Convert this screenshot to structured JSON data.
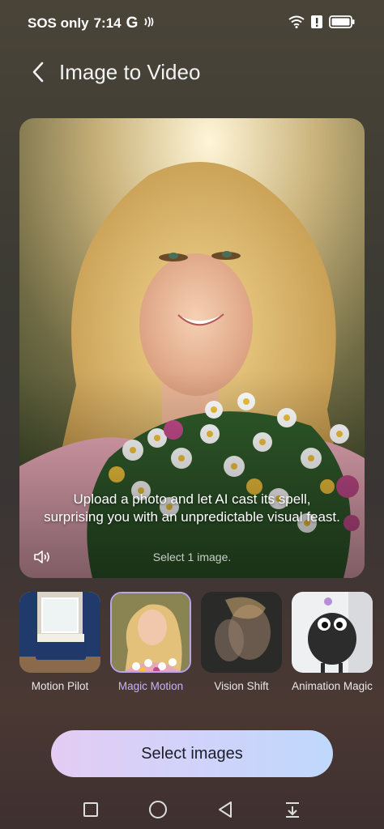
{
  "status_bar": {
    "carrier": "SOS only",
    "time": "7:14",
    "network_letter": "G",
    "icons": [
      "nfc-icon",
      "wifi-icon",
      "alert-icon",
      "battery-icon"
    ]
  },
  "header": {
    "title": "Image to Video",
    "back_icon": "chevron-left-icon"
  },
  "hero": {
    "caption": "Upload a photo and let AI cast its spell, surprising you with an unpredictable visual feast.",
    "hint": "Select 1 image.",
    "sound_icon": "speaker-icon"
  },
  "tiles": [
    {
      "label": "Motion Pilot",
      "selected": false
    },
    {
      "label": "Magic Motion",
      "selected": true
    },
    {
      "label": "Vision Shift",
      "selected": false
    },
    {
      "label": "Animation Magic",
      "selected": false
    }
  ],
  "colors": {
    "accent": "#c6b2f5",
    "button_gradient_start": "#e4ccf3",
    "button_gradient_end": "#bfd8fb"
  },
  "primary_button": {
    "label": "Select images"
  },
  "nav_bar": {
    "icons": [
      "recents-square-icon",
      "home-circle-icon",
      "back-triangle-icon",
      "notification-down-icon"
    ]
  }
}
